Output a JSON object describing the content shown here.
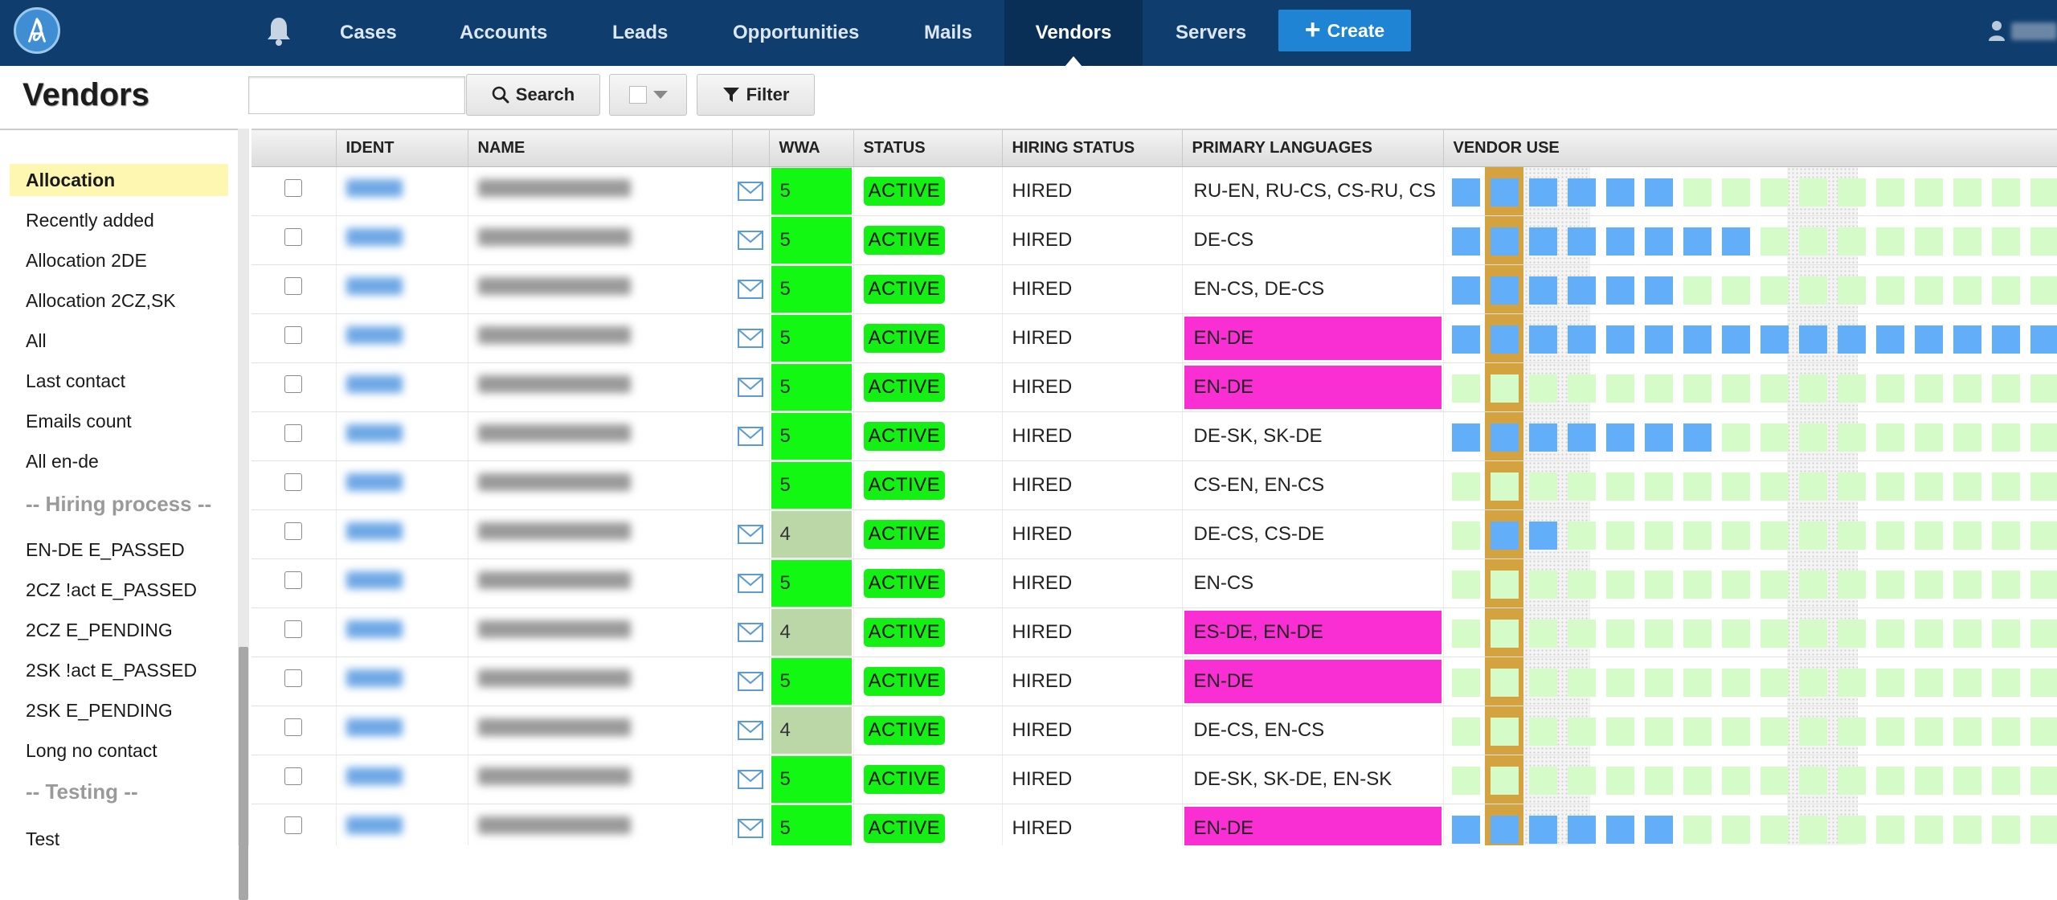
{
  "topbar": {
    "nav": [
      "Cases",
      "Accounts",
      "Leads",
      "Opportunities",
      "Mails",
      "Vendors",
      "Servers"
    ],
    "active": "Vendors",
    "create_label": "Create",
    "colors": {
      "bar": "#0f3e6e",
      "active": "#0a2f56",
      "create": "#1f84d3"
    }
  },
  "toolbar": {
    "page_title": "Vendors",
    "search_value": "",
    "search_label": "Search",
    "filter_label": "Filter"
  },
  "sidebar": {
    "items": [
      {
        "label": "Allocation",
        "selected": true
      },
      {
        "label": "Recently added"
      },
      {
        "label": "Allocation 2DE"
      },
      {
        "label": "Allocation 2CZ,SK"
      },
      {
        "label": "All"
      },
      {
        "label": "Last contact"
      },
      {
        "label": "Emails count"
      },
      {
        "label": "All en-de"
      },
      {
        "group": "-- Hiring process --"
      },
      {
        "label": "EN-DE E_PASSED"
      },
      {
        "label": "2CZ !act E_PASSED"
      },
      {
        "label": "2CZ E_PENDING"
      },
      {
        "label": "2SK !act E_PASSED"
      },
      {
        "label": "2SK E_PENDING"
      },
      {
        "label": "Long no contact"
      },
      {
        "group": "-- Testing --"
      },
      {
        "label": "Test"
      }
    ]
  },
  "table": {
    "columns": [
      "",
      "IDENT",
      "NAME",
      "",
      "WWA",
      "STATUS",
      "HIRING STATUS",
      "PRIMARY LANGUAGES",
      "VENDOR USE"
    ],
    "rows": [
      {
        "mail": true,
        "wwa": "5",
        "status": "ACTIVE",
        "hiring": "HIRED",
        "languages": "RU-EN, RU-CS, CS-RU, CS",
        "highlight": false,
        "use": "BBBBBBGGGGGGGGGG"
      },
      {
        "mail": true,
        "wwa": "5",
        "status": "ACTIVE",
        "hiring": "HIRED",
        "languages": "DE-CS",
        "highlight": false,
        "use": "BBBBBBBBGGGGGGGG"
      },
      {
        "mail": true,
        "wwa": "5",
        "status": "ACTIVE",
        "hiring": "HIRED",
        "languages": "EN-CS, DE-CS",
        "highlight": false,
        "use": "BBBBBBGGGGGGGGGG"
      },
      {
        "mail": true,
        "wwa": "5",
        "status": "ACTIVE",
        "hiring": "HIRED",
        "languages": "EN-DE",
        "highlight": true,
        "use": "BBBBBBBBBBBBBBBB"
      },
      {
        "mail": true,
        "wwa": "5",
        "status": "ACTIVE",
        "hiring": "HIRED",
        "languages": "EN-DE",
        "highlight": true,
        "use": "GGGGGGGGGGGGGGGG"
      },
      {
        "mail": true,
        "wwa": "5",
        "status": "ACTIVE",
        "hiring": "HIRED",
        "languages": "DE-SK, SK-DE",
        "highlight": false,
        "use": "BBBBBBBGGGGGGGGG"
      },
      {
        "mail": false,
        "wwa": "5",
        "status": "ACTIVE",
        "hiring": "HIRED",
        "languages": "CS-EN, EN-CS",
        "highlight": false,
        "use": "GGGGGGGGGGGGGGGG"
      },
      {
        "mail": true,
        "wwa": "4",
        "status": "ACTIVE",
        "hiring": "HIRED",
        "languages": "DE-CS, CS-DE",
        "highlight": false,
        "use": "GBBGGGGGGGGGGGGG"
      },
      {
        "mail": true,
        "wwa": "5",
        "status": "ACTIVE",
        "hiring": "HIRED",
        "languages": "EN-CS",
        "highlight": false,
        "use": "GGGGGGGGGGGGGGGG"
      },
      {
        "mail": true,
        "wwa": "4",
        "status": "ACTIVE",
        "hiring": "HIRED",
        "languages": "ES-DE, EN-DE",
        "highlight": true,
        "use": "GGGGGGGGGGGGGGGG"
      },
      {
        "mail": true,
        "wwa": "5",
        "status": "ACTIVE",
        "hiring": "HIRED",
        "languages": "EN-DE",
        "highlight": true,
        "use": "GGGGGGGGGGGGGGGG"
      },
      {
        "mail": true,
        "wwa": "4",
        "status": "ACTIVE",
        "hiring": "HIRED",
        "languages": "DE-CS, EN-CS",
        "highlight": false,
        "use": "GGGGGGGGGGGGGGGG"
      },
      {
        "mail": true,
        "wwa": "5",
        "status": "ACTIVE",
        "hiring": "HIRED",
        "languages": "DE-SK, SK-DE, EN-SK",
        "highlight": false,
        "use": "GGGGGGGGGGGGGGGG"
      },
      {
        "mail": true,
        "wwa": "5",
        "status": "ACTIVE",
        "hiring": "HIRED",
        "languages": "EN-DE",
        "highlight": true,
        "use": "BBBBBBGGGGGGGGGG"
      }
    ],
    "colors": {
      "wwa_5": "#13f813",
      "wwa_4": "#bcd7a7",
      "status": "#14f014",
      "language_highlight": "#fa2fd3",
      "use_blue": "#63aef8",
      "use_green": "#d5fcc8",
      "today": "#d4a23e"
    }
  }
}
